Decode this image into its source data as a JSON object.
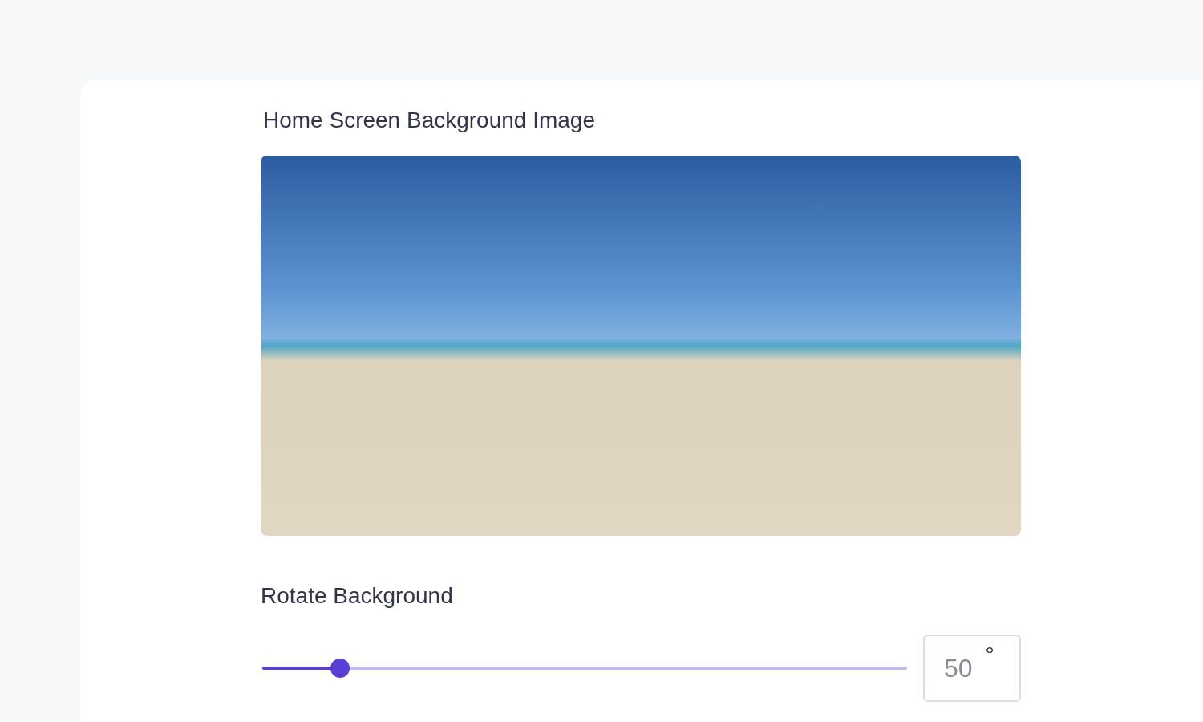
{
  "image_section": {
    "title": "Home Screen Background Image"
  },
  "rotate": {
    "label": "Rotate Background",
    "level": 0.12,
    "value": "50",
    "unit": "°"
  }
}
